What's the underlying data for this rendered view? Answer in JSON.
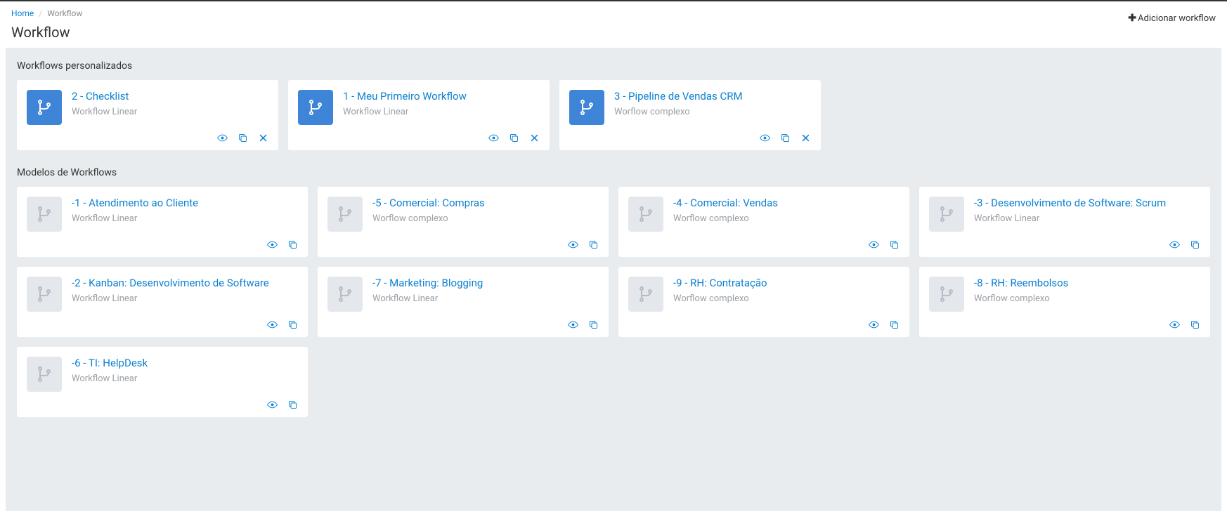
{
  "breadcrumb": {
    "home": "Home",
    "current": "Workflow"
  },
  "page_title": "Workflow",
  "add_button": "Adicionar workflow",
  "sections": {
    "custom": {
      "title": "Workflows personalizados",
      "cards": [
        {
          "title": "2 - Checklist",
          "subtitle": "Workflow Linear",
          "deletable": true,
          "blue": true
        },
        {
          "title": "1 - Meu Primeiro Workflow",
          "subtitle": "Workflow Linear",
          "deletable": true,
          "blue": true
        },
        {
          "title": "3 - Pipeline de Vendas CRM",
          "subtitle": "Worflow complexo",
          "deletable": true,
          "blue": true
        }
      ]
    },
    "templates": {
      "title": "Modelos de Workflows",
      "cards": [
        {
          "title": "-1 - Atendimento ao Cliente",
          "subtitle": "Workflow Linear",
          "deletable": false,
          "blue": false
        },
        {
          "title": "-5 - Comercial: Compras",
          "subtitle": "Worflow complexo",
          "deletable": false,
          "blue": false
        },
        {
          "title": "-4 - Comercial: Vendas",
          "subtitle": "Worflow complexo",
          "deletable": false,
          "blue": false
        },
        {
          "title": "-3 - Desenvolvimento de Software: Scrum",
          "subtitle": "Workflow Linear",
          "deletable": false,
          "blue": false
        },
        {
          "title": "-2 - Kanban: Desenvolvimento de Software",
          "subtitle": "Workflow Linear",
          "deletable": false,
          "blue": false
        },
        {
          "title": "-7 - Marketing: Blogging",
          "subtitle": "Workflow Linear",
          "deletable": false,
          "blue": false
        },
        {
          "title": "-9 - RH: Contratação",
          "subtitle": "Worflow complexo",
          "deletable": false,
          "blue": false
        },
        {
          "title": "-8 - RH: Reembolsos",
          "subtitle": "Worflow complexo",
          "deletable": false,
          "blue": false
        },
        {
          "title": "-6 - TI: HelpDesk",
          "subtitle": "Workflow Linear",
          "deletable": false,
          "blue": false
        }
      ]
    }
  }
}
